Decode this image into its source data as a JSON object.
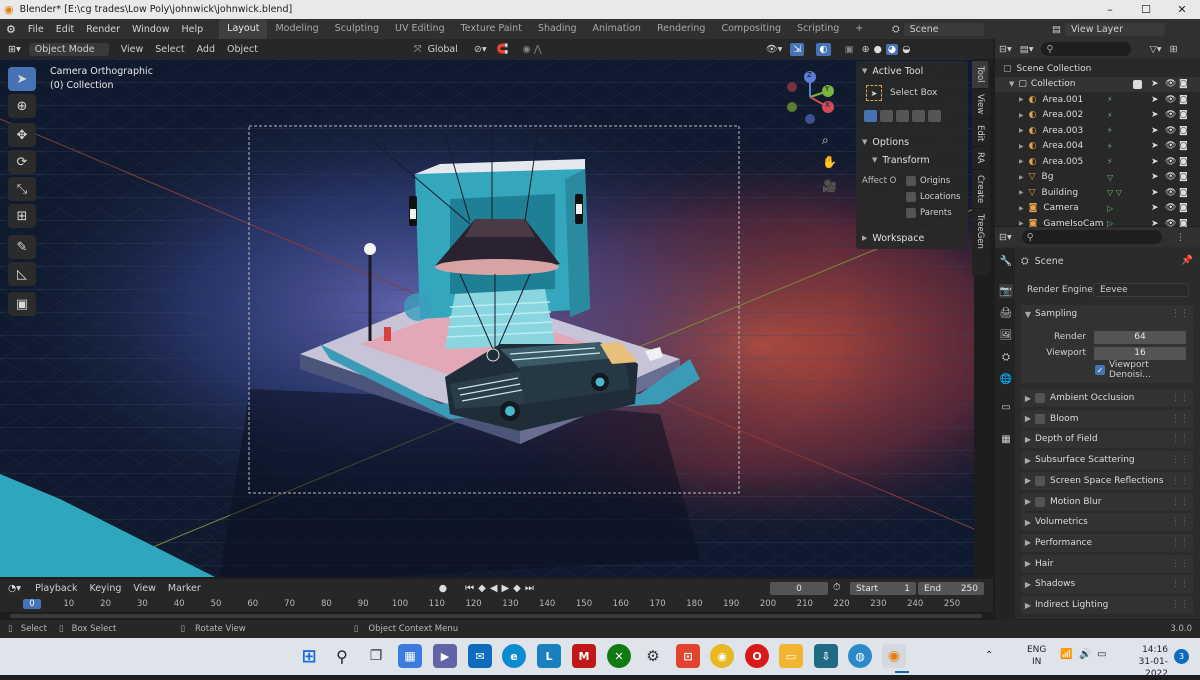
{
  "window": {
    "title": "Blender* [E:\\cg trades\\Low Poly\\johnwick\\johnwick.blend]",
    "minimize": "–",
    "maximize": "☐",
    "close": "✕"
  },
  "menu": {
    "items": [
      "File",
      "Edit",
      "Render",
      "Window",
      "Help"
    ],
    "workspaces": [
      "Layout",
      "Modeling",
      "Sculpting",
      "UV Editing",
      "Texture Paint",
      "Shading",
      "Animation",
      "Rendering",
      "Compositing",
      "Scripting"
    ],
    "add_workspace": "+",
    "scene": "Scene",
    "view_layer": "View Layer"
  },
  "viewport_header": {
    "mode": "Object Mode",
    "menus": [
      "View",
      "Select",
      "Add",
      "Object"
    ],
    "orientation": "Global"
  },
  "viewport": {
    "camera_label": "Camera Orthographic",
    "collection_label": "(0) Collection",
    "gizmo": {
      "x": "X",
      "y": "Y",
      "z": "Z"
    }
  },
  "npanel": {
    "active_tool_title": "Active Tool",
    "select_box": "Select Box",
    "options_title": "Options",
    "transform_title": "Transform",
    "affect_label": "Affect O",
    "affect_options": [
      "Origins",
      "Locations",
      "Parents"
    ],
    "workspace_title": "Workspace",
    "tabs": [
      "Tool",
      "View",
      "Edit",
      "RA",
      "Create",
      "TreeGen"
    ]
  },
  "outliner": {
    "scene_collection": "Scene Collection",
    "collection": "Collection",
    "objects": [
      "Area.001",
      "Area.002",
      "Area.003",
      "Area.004",
      "Area.005",
      "Bg",
      "Building",
      "Camera",
      "GameIsoCam"
    ]
  },
  "properties": {
    "scene": "Scene",
    "render_engine_label": "Render Engine",
    "render_engine": "Eevee",
    "sampling": "Sampling",
    "render_label": "Render",
    "render_value": "64",
    "viewport_label": "Viewport",
    "viewport_value": "16",
    "viewport_denoise": "Viewport Denoisi...",
    "panels": [
      {
        "label": "Ambient Occlusion",
        "checkbox": true
      },
      {
        "label": "Bloom",
        "checkbox": true
      },
      {
        "label": "Depth of Field",
        "checkbox": false
      },
      {
        "label": "Subsurface Scattering",
        "checkbox": false
      },
      {
        "label": "Screen Space Reflections",
        "checkbox": true
      },
      {
        "label": "Motion Blur",
        "checkbox": true
      },
      {
        "label": "Volumetrics",
        "checkbox": false
      },
      {
        "label": "Performance",
        "checkbox": false
      },
      {
        "label": "Hair",
        "checkbox": false
      },
      {
        "label": "Shadows",
        "checkbox": false
      },
      {
        "label": "Indirect Lighting",
        "checkbox": false
      }
    ]
  },
  "timeline": {
    "menus": [
      "Playback",
      "Keying",
      "View",
      "Marker"
    ],
    "current_frame": "0",
    "start_label": "Start",
    "start_value": "1",
    "end_label": "End",
    "end_value": "250",
    "ticks": [
      "0",
      "10",
      "20",
      "30",
      "40",
      "50",
      "60",
      "70",
      "80",
      "90",
      "100",
      "110",
      "120",
      "130",
      "140",
      "150",
      "160",
      "170",
      "180",
      "190",
      "200",
      "210",
      "220",
      "230",
      "240",
      "250"
    ]
  },
  "statusbar": {
    "select": "Select",
    "box_select": "Box Select",
    "rotate_view": "Rotate View",
    "context_menu": "Object Context Menu",
    "version": "3.0.0"
  },
  "taskbar": {
    "language": "ENG",
    "region": "IN",
    "time": "14:16",
    "date": "31-01-2022",
    "notifications": "3"
  },
  "colors": {
    "accent": "#4772b3",
    "viewport_dark": "#0f1a2e",
    "glow_red": "#c0473a",
    "building_teal": "#2fa3b5"
  }
}
